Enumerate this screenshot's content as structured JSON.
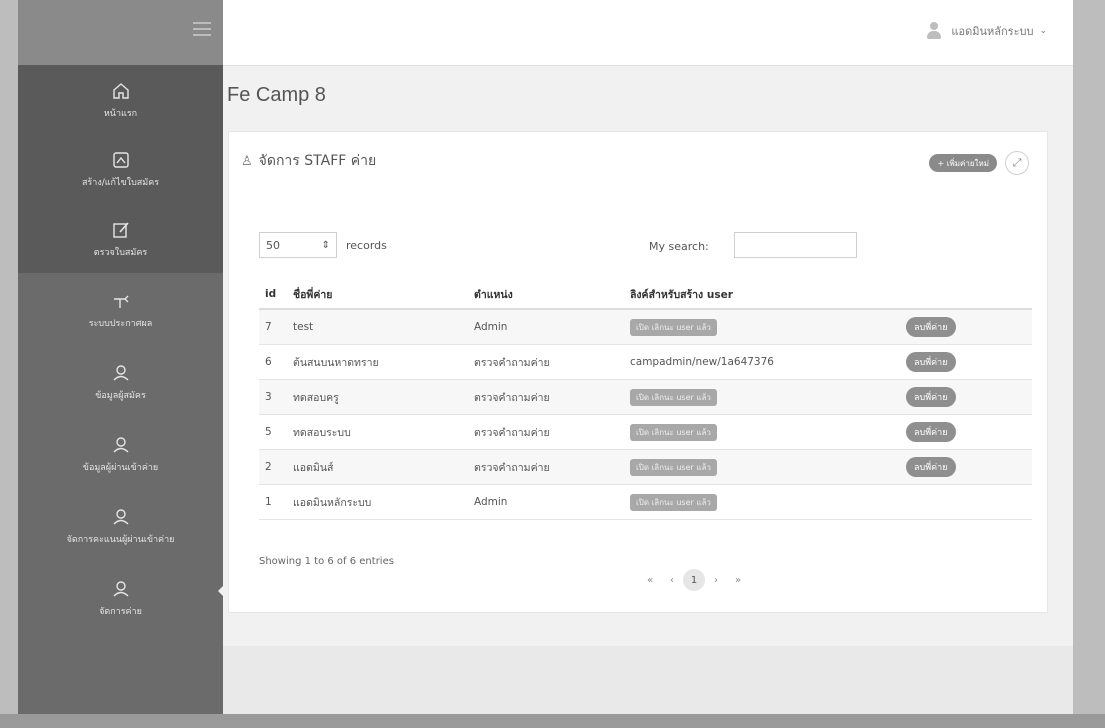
{
  "header": {
    "user_name": "แอดมินหลักระบบ"
  },
  "sidebar": {
    "items": [
      {
        "label": "หน้าแรก",
        "icon": "home-icon"
      },
      {
        "label": "สร้าง/แก้ไขใบสมัคร",
        "icon": "form-icon"
      },
      {
        "label": "ตรวจใบสมัคร",
        "icon": "edit-icon"
      },
      {
        "label": "ระบบประกาศผล",
        "icon": "announce-icon"
      },
      {
        "label": "ข้อมูลผู้สมัคร",
        "icon": "users-icon"
      },
      {
        "label": "ข้อมูลผู้ผ่านเข้าค่าย",
        "icon": "user-icon"
      },
      {
        "label": "จัดการคะแนนผู้ผ่านเข้าค่าย",
        "icon": "user-icon"
      },
      {
        "label": "จัดการค่าย",
        "icon": "user-icon"
      }
    ]
  },
  "page": {
    "title": "Fe Camp 8"
  },
  "card": {
    "heading": "จัดการ STAFF ค่าย",
    "add_label": "+ เพิ่มค่ายใหม่",
    "records_value": "50",
    "records_label": "records",
    "search_label": "My search:",
    "search_placeholder": ""
  },
  "table": {
    "columns": [
      "id",
      "ชื่อพี่ค่าย",
      "ตำแหน่ง",
      "ลิงค์สำหรับสร้าง user",
      ""
    ],
    "rows": [
      {
        "id": "7",
        "name": "test",
        "position": "Admin",
        "link": "เปิด เลิกนะ user แล้ว",
        "link_is_pill": true,
        "action": "ลบพี่ค่าย"
      },
      {
        "id": "6",
        "name": "ต้นสนบนหาดทราย",
        "position": "ตรวจคำถามค่าย",
        "link": "campadmin/new/1a647376",
        "link_is_pill": false,
        "action": "ลบพี่ค่าย"
      },
      {
        "id": "3",
        "name": "ทดสอบครู",
        "position": "ตรวจคำถามค่าย",
        "link": "เปิด เลิกนะ user แล้ว",
        "link_is_pill": true,
        "action": "ลบพี่ค่าย"
      },
      {
        "id": "5",
        "name": "ทดสอบระบบ",
        "position": "ตรวจคำถามค่าย",
        "link": "เปิด เลิกนะ user แล้ว",
        "link_is_pill": true,
        "action": "ลบพี่ค่าย"
      },
      {
        "id": "2",
        "name": "แอดมินส์",
        "position": "ตรวจคำถามค่าย",
        "link": "เปิด เลิกนะ user แล้ว",
        "link_is_pill": true,
        "action": "ลบพี่ค่าย"
      },
      {
        "id": "1",
        "name": "แอดมินหลักระบบ",
        "position": "Admin",
        "link": "เปิด เลิกนะ user แล้ว",
        "link_is_pill": true,
        "action": ""
      }
    ]
  },
  "footer": {
    "showing": "Showing 1 to 6 of 6 entries",
    "pager": [
      "«",
      "‹",
      "1",
      "›",
      "»"
    ]
  }
}
